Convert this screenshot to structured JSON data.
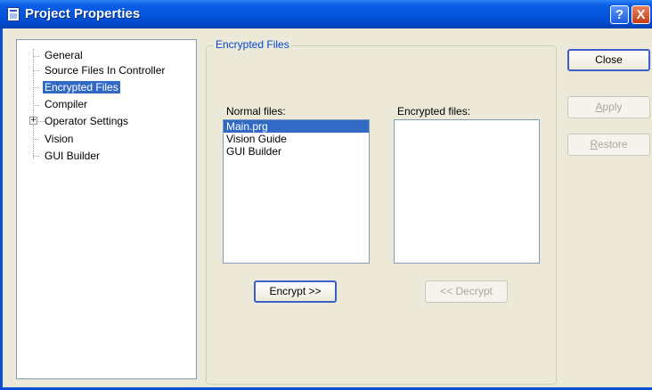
{
  "window": {
    "title": "Project Properties",
    "help_icon": "?",
    "close_icon": "X"
  },
  "tree": {
    "items": [
      {
        "label": "General",
        "selected": false
      },
      {
        "label": "Source Files In Controller",
        "selected": false
      },
      {
        "label": "Encrypted Files",
        "selected": true
      },
      {
        "label": "Compiler",
        "selected": false
      },
      {
        "label": "Operator Settings",
        "selected": false,
        "expander": "+"
      },
      {
        "label": "Vision",
        "selected": false
      },
      {
        "label": "GUI Builder",
        "selected": false
      }
    ]
  },
  "group": {
    "title": "Encrypted Files"
  },
  "normal_files": {
    "label": "Normal files:",
    "items": [
      "Main.prg",
      "Vision Guide",
      "GUI Builder"
    ],
    "selected_index": 0
  },
  "encrypted_files": {
    "label": "Encrypted files:",
    "items": []
  },
  "buttons": {
    "encrypt": "Encrypt >>",
    "decrypt": "<< Decrypt",
    "close": "Close",
    "apply": {
      "first": "A",
      "rest": "pply"
    },
    "restore": {
      "first": "R",
      "rest": "estore"
    }
  },
  "colors": {
    "selection": "#316ac5",
    "titlebar": "#0354dc",
    "dialog_bg": "#ece9d8",
    "group_title": "#0046d5"
  }
}
